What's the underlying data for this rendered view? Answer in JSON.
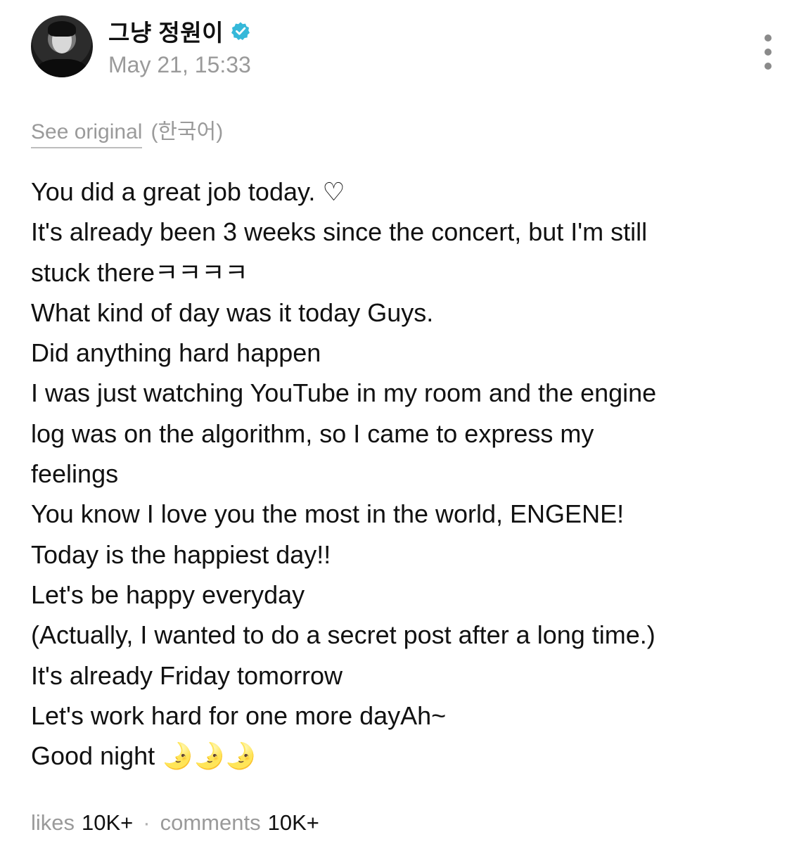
{
  "author": {
    "name": "그냥 정원이",
    "timestamp": "May 21, 15:33",
    "verified_icon": "verified-badge-icon",
    "verified_color": "#35b8d9"
  },
  "translation": {
    "see_original_label": "See original",
    "language_label": "(한국어)"
  },
  "post": {
    "lines": [
      "You did a great job today. ♡",
      "It's already been 3 weeks since the concert, but I'm still",
      "stuck thereㅋㅋㅋㅋ",
      "What kind of day was it today Guys.",
      "Did anything hard happen",
      "I was just watching YouTube in my room and the engine",
      "log was on the algorithm, so I came to express my",
      "feelings",
      "You know I love you the most in the world, ENGENE!",
      "Today is the happiest day!!",
      "Let's be happy everyday",
      "(Actually, I wanted to do a secret post after a long time.)",
      "It's already Friday tomorrow",
      "Let's work hard for one more dayAh~",
      "Good night 🌛🌛🌛"
    ]
  },
  "footer": {
    "likes_label": "likes",
    "likes_count": "10K+",
    "separator": "·",
    "comments_label": "comments",
    "comments_count": "10K+"
  }
}
